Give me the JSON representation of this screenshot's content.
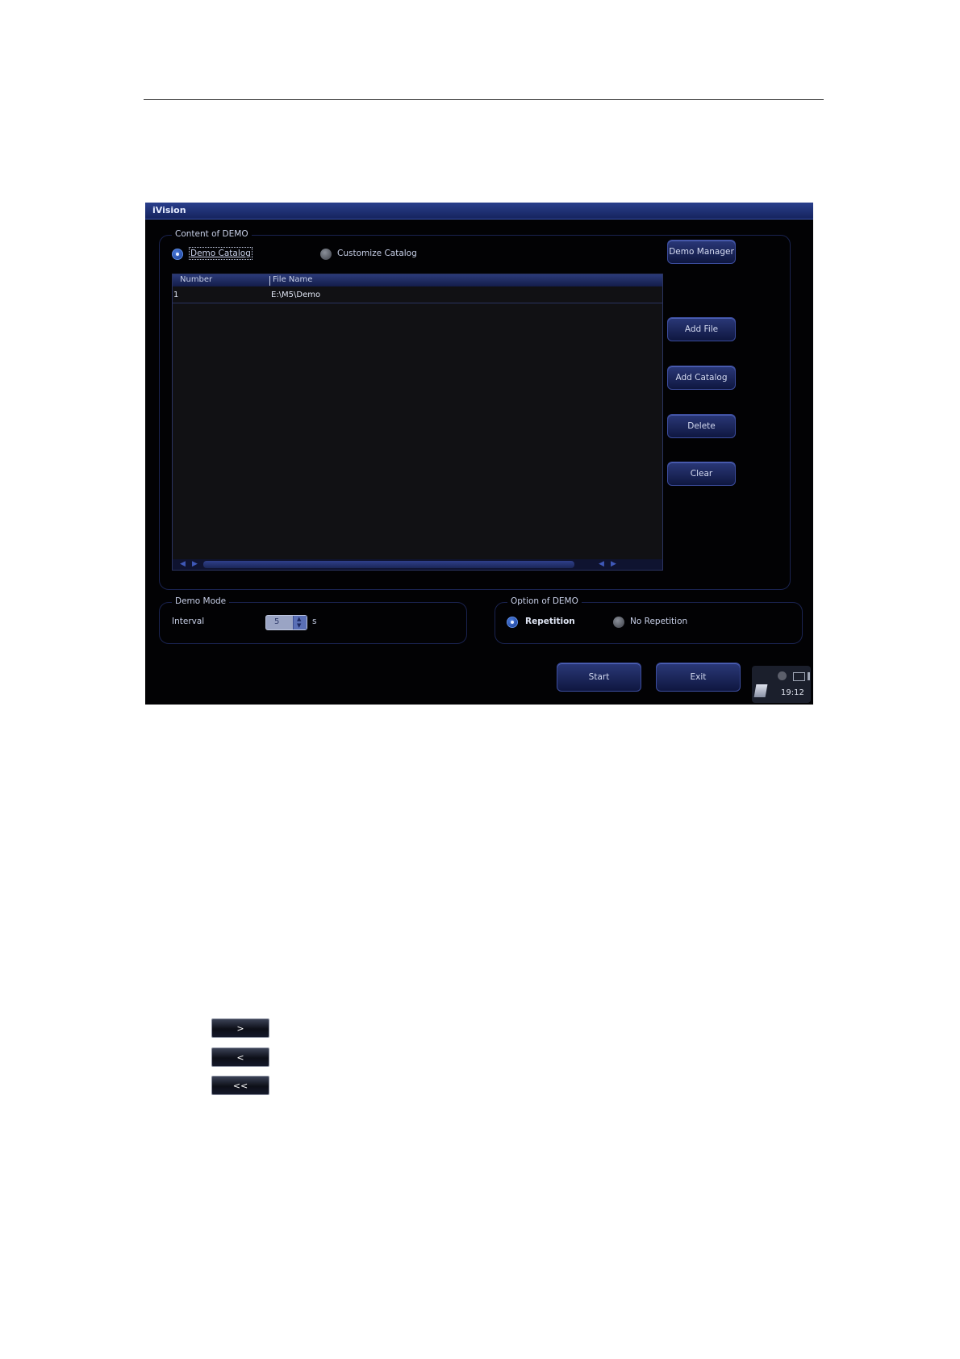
{
  "window": {
    "title": "iVision"
  },
  "content_group": {
    "label": "Content of DEMO",
    "radio_demo_catalog": "Demo Catalog",
    "radio_customize_catalog": "Customize Catalog",
    "table": {
      "columns": [
        "Number",
        "File Name"
      ],
      "rows": [
        {
          "number": "1",
          "file_name": "E:\\M5\\Demo"
        }
      ]
    }
  },
  "side_buttons": {
    "demo_manager": "Demo Manager",
    "add_file": "Add File",
    "add_catalog": "Add Catalog",
    "delete": "Delete",
    "clear": "Clear"
  },
  "demo_mode": {
    "label": "Demo Mode",
    "interval_label": "Interval",
    "interval_value": "5",
    "unit": "s"
  },
  "option_group": {
    "label": "Option of DEMO",
    "repetition": "Repetition",
    "no_repetition": "No Repetition"
  },
  "footer": {
    "start": "Start",
    "exit": "Exit",
    "time": "19:12"
  },
  "nav_buttons": {
    "next": ">",
    "prev": "<",
    "first": "<<"
  },
  "colors": {
    "window_bg": "#020204",
    "title_bar": "#1f2f78",
    "button": "#1c2866",
    "accent": "#3b52a8"
  }
}
